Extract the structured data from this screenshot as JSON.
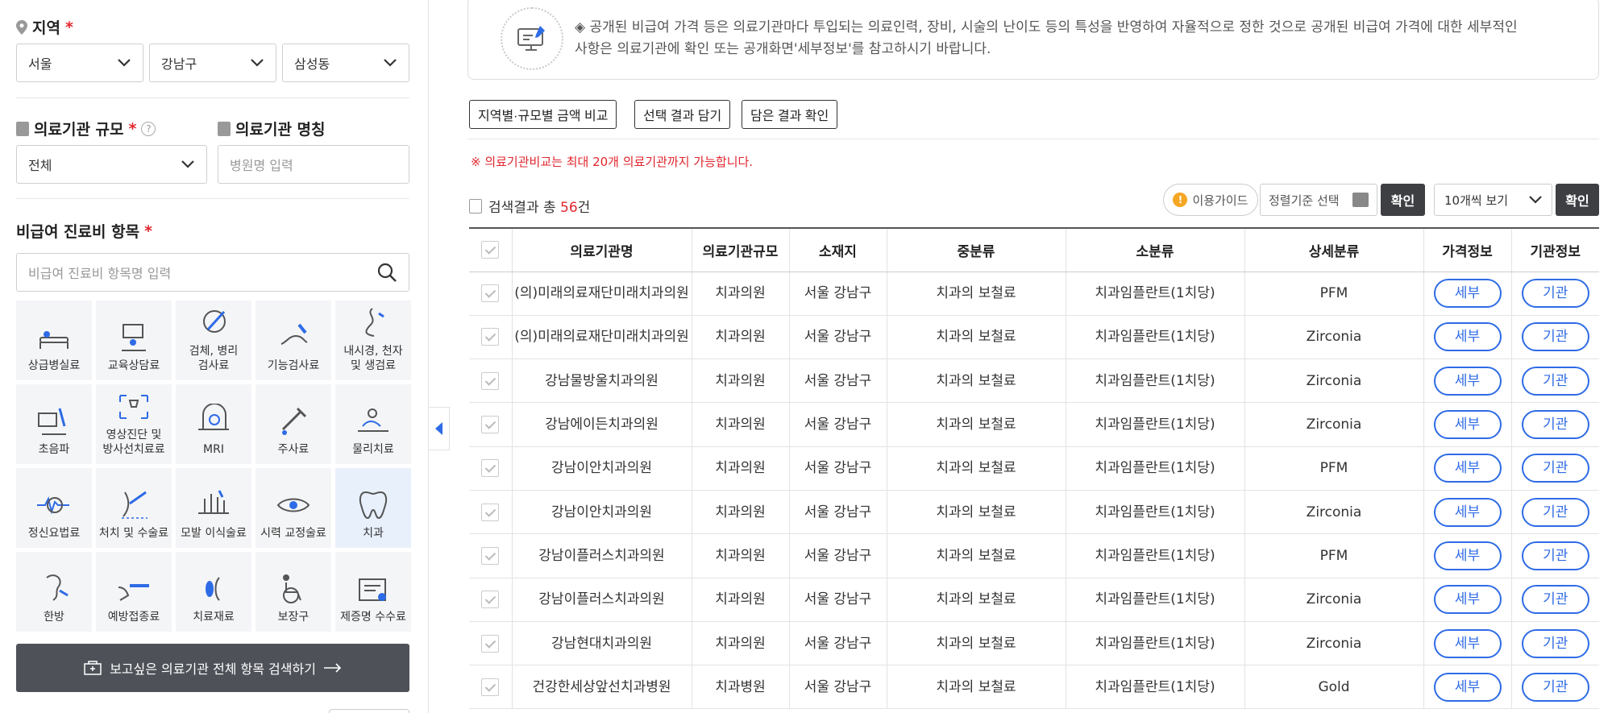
{
  "sidebar": {
    "region": {
      "label": "지역",
      "required": "*",
      "city": "서울",
      "district": "강남구",
      "town": "삼성동"
    },
    "scale": {
      "label": "의료기관 규모",
      "required": "*",
      "help": "?",
      "value": "전체"
    },
    "name": {
      "label": "의료기관 명칭",
      "placeholder": "병원명 입력"
    },
    "items": {
      "label": "비급여 진료비 항목",
      "required": "*",
      "placeholder": "비급여 진료비 항목명 입력"
    },
    "categories": [
      {
        "label": "상급병실료",
        "icon": "hospital-bed-icon"
      },
      {
        "label": "교육상담료",
        "icon": "consultation-icon"
      },
      {
        "label": "검체, 병리\n검사료",
        "icon": "specimen-icon"
      },
      {
        "label": "기능검사료",
        "icon": "function-test-icon"
      },
      {
        "label": "내시경, 천자\n및 생검료",
        "icon": "endoscope-icon"
      },
      {
        "label": "초음파",
        "icon": "ultrasound-icon"
      },
      {
        "label": "영상진단 및\n방사선치료료",
        "icon": "radiology-icon"
      },
      {
        "label": "MRI",
        "icon": "mri-icon"
      },
      {
        "label": "주사료",
        "icon": "injection-icon"
      },
      {
        "label": "물리치료",
        "icon": "physical-therapy-icon"
      },
      {
        "label": "정신요법료",
        "icon": "psychotherapy-icon"
      },
      {
        "label": "처치 및 수술료",
        "icon": "surgery-icon"
      },
      {
        "label": "모발 이식술료",
        "icon": "hair-transplant-icon"
      },
      {
        "label": "시력 교정술료",
        "icon": "vision-correction-icon"
      },
      {
        "label": "치과",
        "icon": "tooth-icon",
        "active": true
      },
      {
        "label": "한방",
        "icon": "oriental-medicine-icon"
      },
      {
        "label": "예방접종료",
        "icon": "vaccination-icon"
      },
      {
        "label": "치료재료",
        "icon": "treatment-material-icon"
      },
      {
        "label": "보장구",
        "icon": "wheelchair-icon"
      },
      {
        "label": "제증명 수수료",
        "icon": "certificate-icon"
      }
    ],
    "search_all_label": "보고싶은 의료기관 전체 항목 검색하기"
  },
  "notice": {
    "text_line1": "◈ 공개된 비급여 가격 등은 의료기관마다 투입되는 의료인력, 장비, 시술의 난이도 등의 특성을 반영하여 자율적으로 정한 것으로 공개된 비급여 가격에 대한 세부적인",
    "text_line2": "사항은 의료기관에 확인 또는 공개화면'세부정보'를 참고하시기 바랍니다."
  },
  "toolbar": {
    "compare": "지역별·규모별 금액 비교",
    "add_selected": "선택 결과 담기",
    "view_saved": "담은 결과 확인",
    "limit_note": "※ 의료기관비교는 최대 20개 의료기관까지 가능합니다.",
    "result_prefix": "검색결과 총 ",
    "result_count": "56",
    "result_suffix": "건",
    "guide": "이용가이드",
    "sort_placeholder": "정렬기준 선택",
    "confirm": "확인",
    "per_page": "10개씩 보기"
  },
  "table": {
    "headers": [
      "의료기관명",
      "의료기관규모",
      "소재지",
      "중분류",
      "소분류",
      "상세분류",
      "가격정보",
      "기관정보"
    ],
    "detail_label": "세부",
    "org_label": "기관",
    "rows": [
      {
        "name": "(의)미래의료재단미래치과의원",
        "scale": "치과의원",
        "loc": "서울 강남구",
        "mid": "치과의 보철료",
        "sub": "치과임플란트(1치당)",
        "detail": "PFM"
      },
      {
        "name": "(의)미래의료재단미래치과의원",
        "scale": "치과의원",
        "loc": "서울 강남구",
        "mid": "치과의 보철료",
        "sub": "치과임플란트(1치당)",
        "detail": "Zirconia"
      },
      {
        "name": "강남물방울치과의원",
        "scale": "치과의원",
        "loc": "서울 강남구",
        "mid": "치과의 보철료",
        "sub": "치과임플란트(1치당)",
        "detail": "Zirconia"
      },
      {
        "name": "강남에이든치과의원",
        "scale": "치과의원",
        "loc": "서울 강남구",
        "mid": "치과의 보철료",
        "sub": "치과임플란트(1치당)",
        "detail": "Zirconia"
      },
      {
        "name": "강남이안치과의원",
        "scale": "치과의원",
        "loc": "서울 강남구",
        "mid": "치과의 보철료",
        "sub": "치과임플란트(1치당)",
        "detail": "PFM"
      },
      {
        "name": "강남이안치과의원",
        "scale": "치과의원",
        "loc": "서울 강남구",
        "mid": "치과의 보철료",
        "sub": "치과임플란트(1치당)",
        "detail": "Zirconia"
      },
      {
        "name": "강남이플러스치과의원",
        "scale": "치과의원",
        "loc": "서울 강남구",
        "mid": "치과의 보철료",
        "sub": "치과임플란트(1치당)",
        "detail": "PFM"
      },
      {
        "name": "강남이플러스치과의원",
        "scale": "치과의원",
        "loc": "서울 강남구",
        "mid": "치과의 보철료",
        "sub": "치과임플란트(1치당)",
        "detail": "Zirconia"
      },
      {
        "name": "강남현대치과의원",
        "scale": "치과의원",
        "loc": "서울 강남구",
        "mid": "치과의 보철료",
        "sub": "치과임플란트(1치당)",
        "detail": "Zirconia"
      },
      {
        "name": "건강한세상앞선치과병원",
        "scale": "치과병원",
        "loc": "서울 강남구",
        "mid": "치과의 보철료",
        "sub": "치과임플란트(1치당)",
        "detail": "Gold"
      }
    ]
  },
  "colors": {
    "accent_blue": "#2e6be6",
    "alert_red": "#e0262d",
    "dark_button": "#3d3f43"
  }
}
